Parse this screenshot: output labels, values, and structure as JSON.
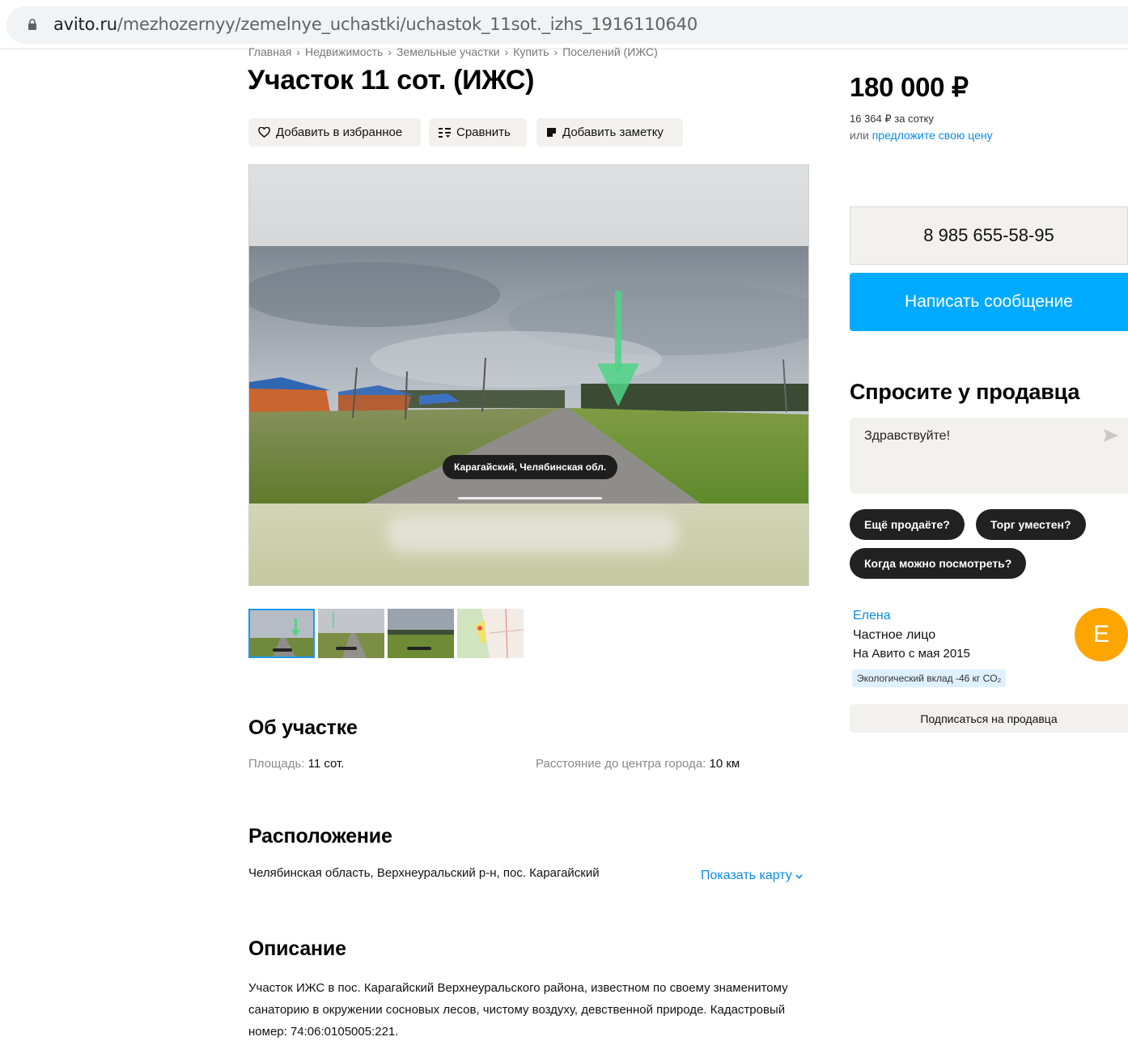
{
  "browser": {
    "url_domain": "avito.ru",
    "url_path": "/mezhozernyy/zemelnye_uchastki/uchastok_11sot._izhs_1916110640"
  },
  "breadcrumbs": [
    "Главная",
    "Недвижимость",
    "Земельные участки",
    "Купить",
    "Поселений (ИЖС)"
  ],
  "listing": {
    "title": "Участок 11 сот. (ИЖС)",
    "actions": {
      "favorite": "Добавить в избранное",
      "compare": "Сравнить",
      "note": "Добавить заметку"
    }
  },
  "gallery": {
    "location_caption": "Карагайский, Челябинская обл."
  },
  "about": {
    "title": "Об участке",
    "area_label": "Площадь:",
    "area_value": "11 сот.",
    "distance_label": "Расстояние до центра города:",
    "distance_value": "10 км"
  },
  "location": {
    "title": "Расположение",
    "address": "Челябинская область, Верхнеуральский р-н, пос. Карагайский",
    "show_map": "Показать карту"
  },
  "description": {
    "title": "Описание",
    "text": "Участок ИЖС в пос. Карагайский Верхнеуральского района, известном по своему знаменитому санаторию в окружении сосновых лесов, чистому воздуху, девственной природе. Кадастровый номер: 74:06:0105005:221."
  },
  "sidebar": {
    "price": "180 000 ₽",
    "price_per": "16 364 ₽ за сотку",
    "or_label": "или",
    "offer_link": "предложите свою цену",
    "phone": "8 985 655-58-95",
    "message_button": "Написать сообщение",
    "ask_title": "Спросите у продавца",
    "ask_placeholder": "Здравствуйте!",
    "quick_questions": [
      "Ещё продаёте?",
      "Торг уместен?",
      "Когда можно посмотреть?"
    ],
    "seller": {
      "name": "Елена",
      "type": "Частное лицо",
      "since": "На Авито с мая 2015",
      "eco": "Экологический вклад -46 кг CO₂",
      "avatar_letter": "Е"
    },
    "subscribe": "Подписаться на продавца"
  },
  "colors": {
    "accent": "#00aaff",
    "link": "#0a8be6",
    "avatar": "#ffa500"
  }
}
